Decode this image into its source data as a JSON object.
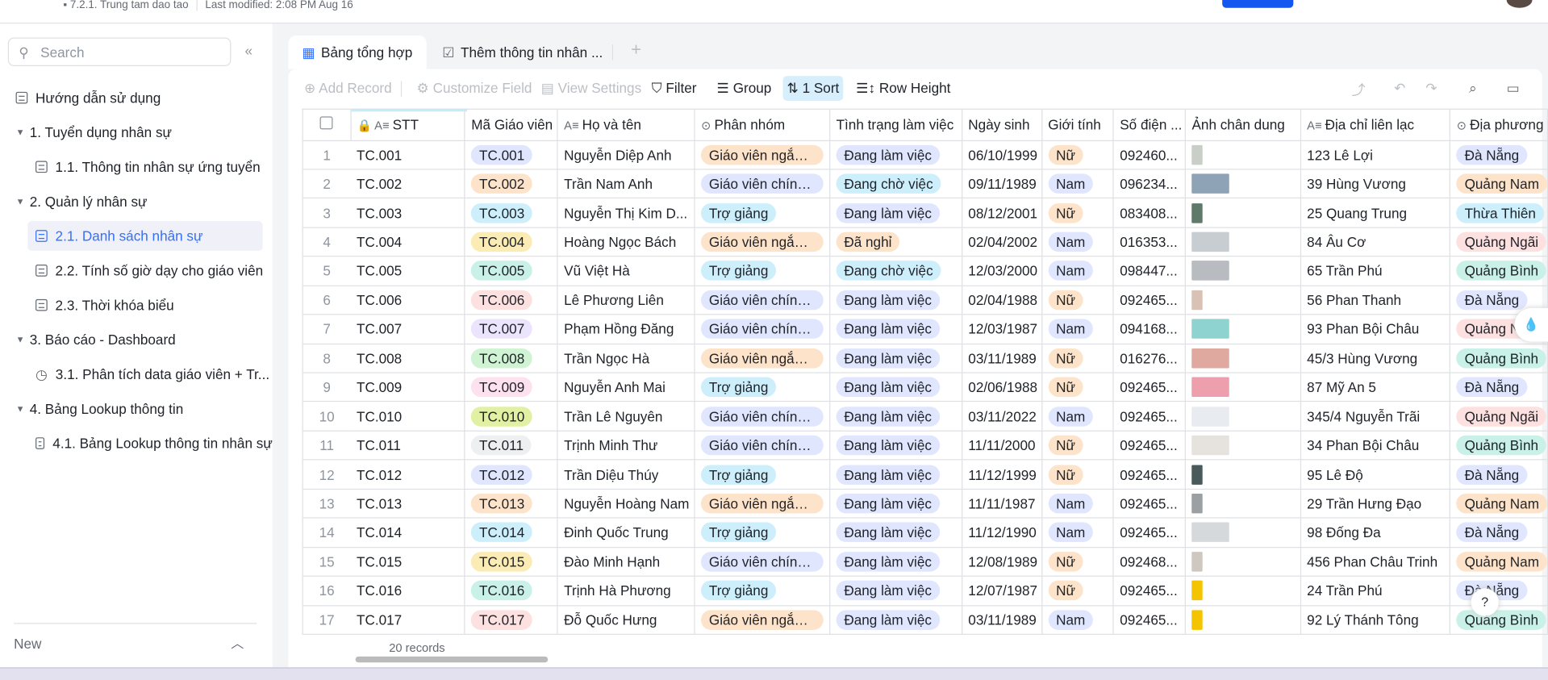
{
  "header": {
    "breadcrumb": "7.2.1. Trung tam dao tao",
    "last_modified": "Last modified: 2:08 PM Aug 16",
    "accent": "#1456f0"
  },
  "sidebar": {
    "search_placeholder": "Search",
    "new_label": "New",
    "items": [
      {
        "label": "Hướng dẫn sử dụng",
        "type": "table",
        "level": 0
      },
      {
        "label": "1. Tuyển dụng nhân sự",
        "type": "folder",
        "level": 0
      },
      {
        "label": "1.1. Thông tin nhân sự ứng tuyển",
        "type": "table",
        "level": 1
      },
      {
        "label": "2. Quản lý nhân sự",
        "type": "folder",
        "level": 0
      },
      {
        "label": "2.1. Danh sách nhân sự",
        "type": "table",
        "level": 1,
        "active": true
      },
      {
        "label": "2.2. Tính số giờ dạy cho giáo viên",
        "type": "table",
        "level": 1
      },
      {
        "label": "2.3. Thời khóa biểu",
        "type": "table",
        "level": 1
      },
      {
        "label": "3. Báo cáo - Dashboard",
        "type": "folder",
        "level": 0
      },
      {
        "label": "3.1. Phân tích data giáo viên + Tr...",
        "type": "dashboard",
        "level": 1
      },
      {
        "label": "4. Bảng Lookup thông tin",
        "type": "folder",
        "level": 0
      },
      {
        "label": "4.1. Bảng Lookup thông tin nhân sự",
        "type": "table",
        "level": 1
      }
    ]
  },
  "tabs": [
    {
      "label": "Bảng tổng hợp",
      "active": true
    },
    {
      "label": "Thêm thông tin nhân ..."
    }
  ],
  "toolbar": {
    "add_record": "Add Record",
    "customize_field": "Customize Field",
    "view_settings": "View Settings",
    "filter": "Filter",
    "group": "Group",
    "sort": "1 Sort",
    "row_height": "Row Height"
  },
  "columns": [
    "STT",
    "Mã Giáo viên",
    "Họ và tên",
    "Phân nhóm",
    "Tình trạng làm việc",
    "Ngày sinh",
    "Giới tính",
    "Số điện ...",
    "Ảnh chân dung",
    "Địa chỉ liên lạc",
    "Địa phương"
  ],
  "tag_colors": {
    "blue": "#dfe6fd",
    "orange": "#fde3c9",
    "cyan": "#cdeefb",
    "yellow": "#fbecb5",
    "teal": "#c9f1e8",
    "red": "#fde0e0",
    "purple": "#ece4fc",
    "green": "#d0f3d4",
    "pink": "#fde1ee",
    "lime": "#e2f0a4",
    "gray": "#eeeff1"
  },
  "rows": [
    {
      "n": "1",
      "stt": "TC.001",
      "ma": "TC.001",
      "mac": "blue",
      "name": "Nguyễn Diệp Anh",
      "group": "Giáo viên ngắn h...",
      "status": "Đang làm việc",
      "dob": "06/10/1999",
      "gender": "Nữ",
      "phone": "092460...",
      "photo": "#c9cfc6",
      "addr": "123 Lê Lợi",
      "region": "Đà Nẵng"
    },
    {
      "n": "2",
      "stt": "TC.002",
      "ma": "TC.002",
      "mac": "orange",
      "name": "Trần Nam Anh",
      "group": "Giáo viên chính t...",
      "status": "Đang chờ việc",
      "dob": "09/11/1989",
      "gender": "Nam",
      "phone": "096234...",
      "photo": "#8ea3b5",
      "addr": "39 Hùng Vương",
      "region": "Quảng Nam"
    },
    {
      "n": "3",
      "stt": "TC.003",
      "ma": "TC.003",
      "mac": "cyan",
      "name": "Nguyễn Thị Kim D...",
      "group": "Trợ giảng",
      "status": "Đang làm việc",
      "dob": "08/12/2001",
      "gender": "Nữ",
      "phone": "083408...",
      "photo": "#5f7a6a",
      "addr": "25 Quang Trung",
      "region": "Thừa Thiên"
    },
    {
      "n": "4",
      "stt": "TC.004",
      "ma": "TC.004",
      "mac": "yellow",
      "name": "Hoàng Ngọc Bách",
      "group": "Giáo viên ngắn h...",
      "status": "Đã nghỉ",
      "dob": "02/04/2002",
      "gender": "Nam",
      "phone": "016353...",
      "photo": "#c8cdd2",
      "addr": "84 Âu Cơ",
      "region": "Quảng Ngãi"
    },
    {
      "n": "5",
      "stt": "TC.005",
      "ma": "TC.005",
      "mac": "teal",
      "name": "Vũ Việt Hà",
      "group": "Trợ giảng",
      "status": "Đang chờ việc",
      "dob": "12/03/2000",
      "gender": "Nam",
      "phone": "098447...",
      "photo": "#b8bcc0",
      "addr": "65 Trần Phú",
      "region": "Quảng Bình"
    },
    {
      "n": "6",
      "stt": "TC.006",
      "ma": "TC.006",
      "mac": "red",
      "name": "Lê Phương Liên",
      "group": "Giáo viên chính t...",
      "status": "Đang làm việc",
      "dob": "02/04/1988",
      "gender": "Nữ",
      "phone": "092465...",
      "photo": "#d9c2b5",
      "addr": "56 Phan Thanh",
      "region": "Đà Nẵng"
    },
    {
      "n": "7",
      "stt": "TC.007",
      "ma": "TC.007",
      "mac": "purple",
      "name": "Phạm Hồng Đăng",
      "group": "Giáo viên chính t...",
      "status": "Đang làm việc",
      "dob": "12/03/1987",
      "gender": "Nam",
      "phone": "094168...",
      "photo": "#8fd3d0",
      "addr": "93 Phan Bội Châu",
      "region": "Quảng Ngãi"
    },
    {
      "n": "8",
      "stt": "TC.008",
      "ma": "TC.008",
      "mac": "green",
      "name": "Trần Ngọc Hà",
      "group": "Giáo viên ngắn h...",
      "status": "Đang làm việc",
      "dob": "03/11/1989",
      "gender": "Nữ",
      "phone": "016276...",
      "photo": "#e0a9a0",
      "addr": "45/3 Hùng Vương",
      "region": "Quảng Bình"
    },
    {
      "n": "9",
      "stt": "TC.009",
      "ma": "TC.009",
      "mac": "pink",
      "name": "Nguyễn Anh Mai",
      "group": "Trợ giảng",
      "status": "Đang làm việc",
      "dob": "02/06/1988",
      "gender": "Nữ",
      "phone": "092465...",
      "photo": "#ee9fae",
      "addr": "87 Mỹ An 5",
      "region": "Đà Nẵng"
    },
    {
      "n": "10",
      "stt": "TC.010",
      "ma": "TC.010",
      "mac": "lime",
      "name": "Trần Lê Nguyên",
      "group": "Giáo viên chính t...",
      "status": "Đang làm việc",
      "dob": "03/11/2022",
      "gender": "Nam",
      "phone": "092465...",
      "photo": "#e8ebef",
      "addr": "345/4 Nguyễn Trãi",
      "region": "Quảng Ngãi"
    },
    {
      "n": "11",
      "stt": "TC.011",
      "ma": "TC.011",
      "mac": "gray",
      "name": "Trịnh Minh Thư",
      "group": "Giáo viên chính t...",
      "status": "Đang làm việc",
      "dob": "11/11/2000",
      "gender": "Nữ",
      "phone": "092465...",
      "photo": "#e6e2de",
      "addr": "34 Phan Bội Châu",
      "region": "Quảng Bình"
    },
    {
      "n": "12",
      "stt": "TC.012",
      "ma": "TC.012",
      "mac": "blue",
      "name": "Trần Diệu Thúy",
      "group": "Trợ giảng",
      "status": "Đang làm việc",
      "dob": "11/12/1999",
      "gender": "Nữ",
      "phone": "092465...",
      "photo": "#4a5a5a",
      "addr": "95 Lê Độ",
      "region": "Đà Nẵng"
    },
    {
      "n": "13",
      "stt": "TC.013",
      "ma": "TC.013",
      "mac": "orange",
      "name": "Nguyễn Hoàng Nam",
      "group": "Giáo viên ngắn h...",
      "status": "Đang làm việc",
      "dob": "11/11/1987",
      "gender": "Nam",
      "phone": "092465...",
      "photo": "#9aa0a4",
      "addr": "29 Trần Hưng Đạo",
      "region": "Quảng Nam"
    },
    {
      "n": "14",
      "stt": "TC.014",
      "ma": "TC.014",
      "mac": "cyan",
      "name": "Đinh Quốc Trung",
      "group": "Trợ giảng",
      "status": "Đang làm việc",
      "dob": "11/12/1990",
      "gender": "Nam",
      "phone": "092465...",
      "photo": "#d6d9dc",
      "addr": "98 Đống Đa",
      "region": "Đà Nẵng"
    },
    {
      "n": "15",
      "stt": "TC.015",
      "ma": "TC.015",
      "mac": "yellow",
      "name": "Đào Minh Hạnh",
      "group": "Giáo viên chính t...",
      "status": "Đang làm việc",
      "dob": "12/08/1989",
      "gender": "Nữ",
      "phone": "092468...",
      "photo": "#cfc8c0",
      "addr": "456 Phan Châu Trinh",
      "region": "Quảng Nam"
    },
    {
      "n": "16",
      "stt": "TC.016",
      "ma": "TC.016",
      "mac": "teal",
      "name": "Trịnh Hà Phương",
      "group": "Trợ giảng",
      "status": "Đang làm việc",
      "dob": "12/07/1987",
      "gender": "Nữ",
      "phone": "092465...",
      "photo": "#f5c400",
      "addr": "24 Trần Phú",
      "region": "Đà Nẵng"
    },
    {
      "n": "17",
      "stt": "TC.017",
      "ma": "TC.017",
      "mac": "red",
      "name": "Đỗ Quốc Hưng",
      "group": "Giáo viên ngắn h...",
      "status": "Đang làm việc",
      "dob": "03/11/1989",
      "gender": "Nam",
      "phone": "092465...",
      "photo": "#f5c400",
      "addr": "92 Lý Thánh Tông",
      "region": "Quảng Bình"
    }
  ],
  "footer": {
    "records": "20 records"
  }
}
